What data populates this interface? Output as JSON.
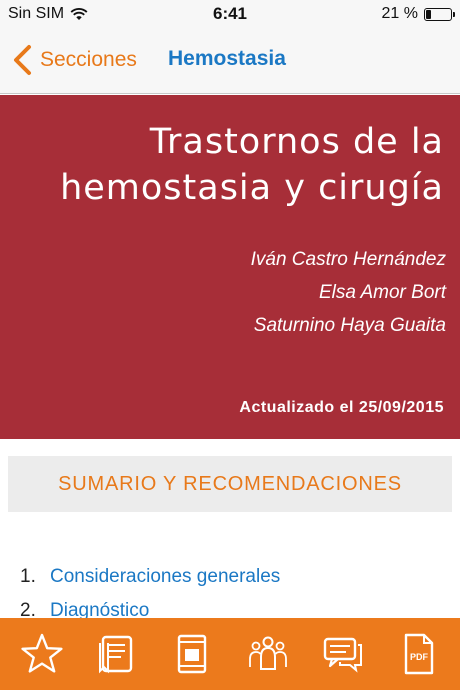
{
  "status_bar": {
    "carrier": "Sin SIM",
    "time": "6:41",
    "battery_percent": "21 %",
    "battery_level": 0.21
  },
  "nav": {
    "back_label": "Secciones",
    "title": "Hemostasia"
  },
  "hero": {
    "title_line1": "Trastornos de la",
    "title_line2": "hemostasia y cirugía",
    "authors": [
      "Iván Castro Hernández",
      "Elsa Amor Bort",
      "Saturnino Haya Guaita"
    ],
    "updated": "Actualizado el 25/09/2015"
  },
  "summary": {
    "label": "SUMARIO Y RECOMENDACIONES"
  },
  "toc": [
    {
      "number": "1.",
      "label": "Consideraciones generales"
    },
    {
      "number": "2.",
      "label": "Diagnóstico"
    }
  ],
  "tab_bar": {
    "icons": [
      "star-icon",
      "notes-icon",
      "book-icon",
      "team-icon",
      "comments-icon",
      "pdf-icon"
    ],
    "pdf_text": "PDF"
  },
  "colors": {
    "accent_orange": "#ec7a1c",
    "link_blue": "#1b78c4",
    "hero_red": "#a72e38"
  }
}
